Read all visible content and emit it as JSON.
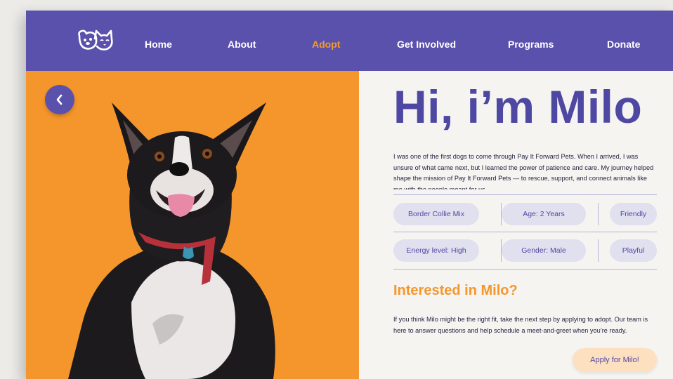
{
  "nav": {
    "logo_icon": "cat-and-dog-logo-icon",
    "items": [
      {
        "label": "Home",
        "active": false
      },
      {
        "label": "About",
        "active": false
      },
      {
        "label": "Adopt",
        "active": true
      },
      {
        "label": "Get Involved",
        "active": false
      },
      {
        "label": "Programs",
        "active": false
      },
      {
        "label": "Donate",
        "active": false
      }
    ]
  },
  "hero": {
    "back_icon": "chevron-left-icon",
    "photo": "dog-photo"
  },
  "pet": {
    "title": "Hi, i’m Milo",
    "intro": "I was one of the first dogs to come through Pay It Forward Pets.  When I arrived, I was unsure of what came next, but I learned the power of patience and care. My journey helped shape the mission of Pay It Forward Pets — to rescue, support, and connect animals like me with the people meant for us.",
    "traits": [
      "Border Collie Mix",
      "Age: 2 Years",
      "Friendly",
      "Energy level: High",
      "Gender: Male",
      "Playful"
    ]
  },
  "interest": {
    "heading": "Interested in Milo?",
    "body": "If you think Milo might be the right fit, take the next step by applying to adopt. Our team is here to answer questions and help schedule a meet-and-greet when you’re ready.",
    "button_label": "Apply for Milo!"
  },
  "colors": {
    "brand_purple": "#5a51ac",
    "accent_orange": "#f5962c",
    "pill_bg": "#e1e0ef",
    "button_bg": "#fde0bf",
    "page_bg": "#f5f4f1"
  }
}
